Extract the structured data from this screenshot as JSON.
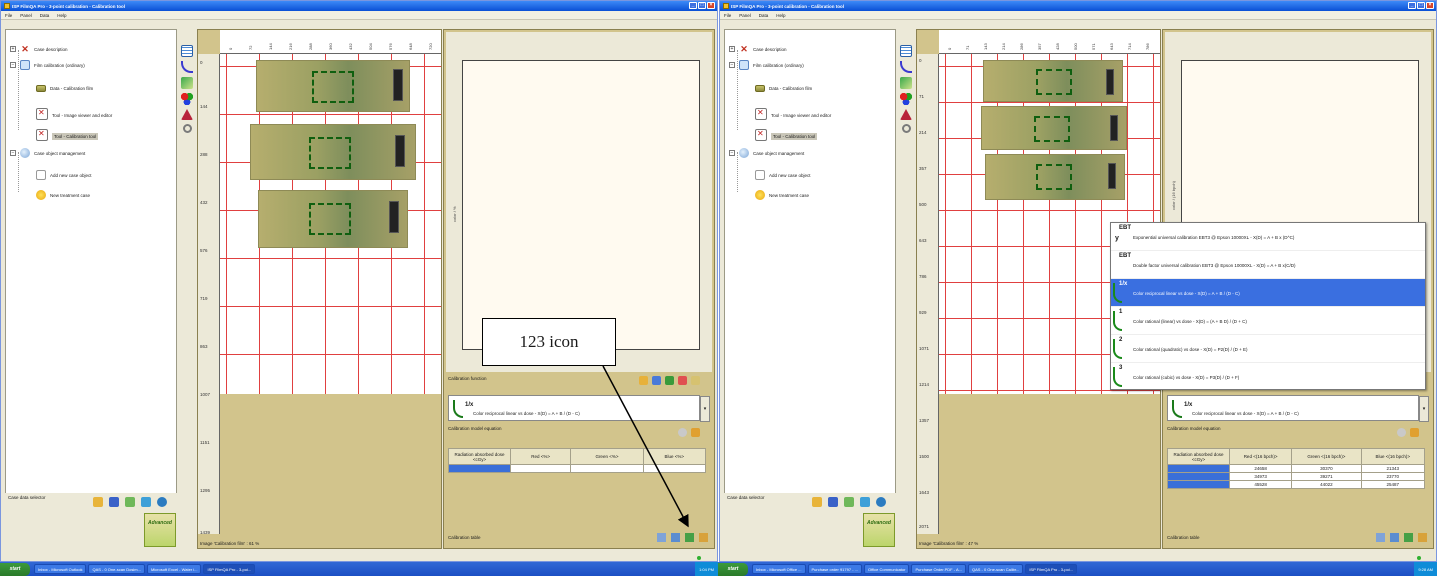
{
  "left_window": {
    "title": "ISP FilmQA Pro - 3-point calibration - Calibration tool",
    "menu": [
      "File",
      "Panel",
      "Data",
      "Help"
    ],
    "tree": [
      {
        "label": "Case description"
      },
      {
        "label": "Film calibration (ordinary)"
      },
      {
        "label": "Data - Calibration film"
      },
      {
        "label": "Tool - Image viewer and editor"
      },
      {
        "label": "Tool - Calibration tool"
      },
      {
        "label": "Case object management"
      },
      {
        "label": "Add new case object"
      },
      {
        "label": "New treatment case"
      }
    ],
    "case_data_label": "Case data selector",
    "logo_text": "Advanced",
    "ruler_left": [
      "0",
      "144",
      "288",
      "432",
      "576",
      "719",
      "863",
      "1007",
      "1151",
      "1295",
      "1439"
    ],
    "ruler_top": [
      "0",
      "72",
      "144",
      "216",
      "288",
      "360",
      "432",
      "504",
      "576",
      "648",
      "720"
    ],
    "image_caption": "Image 'Calibration film' : 61 %",
    "axis_label": "color / %",
    "calibration_function_label": "Calibration function",
    "function_name": "1/x",
    "function_text": "Color reciprocal linear vs dose - X(D) = A + B / (D - C)",
    "model_equation_label": "Calibration model equation",
    "table_headers": [
      "Radiation absorbed dose <cGy>",
      "Red <%>",
      "Green <%>",
      "Blue <%>"
    ],
    "table_rows": [
      [
        "",
        "",
        "",
        ""
      ]
    ],
    "calibration_table_label": "Calibration table"
  },
  "right_window": {
    "title": "ISP FilmQA Pro - 3-point calibration - Calibration tool",
    "menu": [
      "File",
      "Panel",
      "Data",
      "Help"
    ],
    "tree": [
      {
        "label": "Case description"
      },
      {
        "label": "Film calibration (ordinary)"
      },
      {
        "label": "Data - Calibration film"
      },
      {
        "label": "Tool - Image viewer and editor"
      },
      {
        "label": "Tool - Calibration tool"
      },
      {
        "label": "Case object management"
      },
      {
        "label": "Add new case object"
      },
      {
        "label": "New treatment case"
      }
    ],
    "case_data_label": "Case data selector",
    "logo_text": "Advanced",
    "ruler_left": [
      "0",
      "71",
      "214",
      "357",
      "500",
      "643",
      "786",
      "929",
      "1071",
      "1214",
      "1357",
      "1500",
      "1643",
      "1786",
      "1929",
      "2071"
    ],
    "ruler_top": [
      "0",
      "71",
      "143",
      "214",
      "286",
      "357",
      "428",
      "500",
      "571",
      "643",
      "714",
      "786"
    ],
    "image_caption": "Image 'Calibration film' : 47 %",
    "axis_label": "color / (16 bpch)",
    "function_name": "1/x",
    "function_text": "Color reciprocal linear vs dose - X(D) = A + B / (D - C)",
    "model_equation_label": "Calibration model equation",
    "table_headers": [
      "Radiation absorbed dose <cGy>",
      "Red <(16 bpch)>",
      "Green <(16 bpch)>",
      "Blue <(16 bpch)>"
    ],
    "table_rows": [
      [
        "",
        "24658",
        "30370",
        "21343"
      ],
      [
        "",
        "34973",
        "39271",
        "23770"
      ],
      [
        "",
        "45528",
        "44022",
        "25487"
      ]
    ],
    "calibration_table_label": "Calibration table",
    "dropdown": [
      {
        "badge": "EBT",
        "sup": "y",
        "text": "Exponential universal calibration EBT3 @ Epson 10000XL - X(D) = A + B x (D^C)"
      },
      {
        "badge": "EBT",
        "sup": "",
        "text": "Double factor universal calibration EBT3 @ Epson 10000XL - X(D) = A + B x(C/D)"
      },
      {
        "badge": "1/x",
        "sup": "",
        "text": "Color reciprocal linear vs dose - X(D) = A + B / (D - C)",
        "selected": true
      },
      {
        "badge": "1",
        "sup": "",
        "text": "Color rational (linear) vs dose - X(D) = (A + B D) / (D + C)"
      },
      {
        "badge": "2",
        "sup": "",
        "text": "Color rational (quadratic) vs dose - X(D) = P2(D) / (D + E)"
      },
      {
        "badge": "3",
        "sup": "",
        "text": "Color rational (cubic) vs dose - X(D) = P3(D) / (D + F)"
      }
    ]
  },
  "annotation": {
    "callout_text": "123 icon"
  },
  "taskbar": {
    "left": {
      "start": "start",
      "tasks": [
        "Inbox - Microsoft Outlook",
        "QAS - 0 One-scan Dosim...",
        "Microsoft Excel - Water i...",
        "ISP FilmQA Pro - 3-poi..."
      ],
      "clock": "1:04 PM"
    },
    "right": {
      "start": "start",
      "tasks": [
        "Inbox - Microsoft Office ...",
        "Purchase order 91797 - ...",
        "Office Communicator",
        "Purchase Order.PDF - A...",
        "QAS - 0 One-scan Calibr...",
        "ISP FilmQA Pro - 3-poi..."
      ],
      "clock": "9:28 AM"
    }
  },
  "colors": {
    "titlebar": "#0a4fd5",
    "panel": "#d2c48c",
    "selection": "#3a6fe0",
    "grid": "#e04040",
    "roi": "#0f5f0f"
  }
}
